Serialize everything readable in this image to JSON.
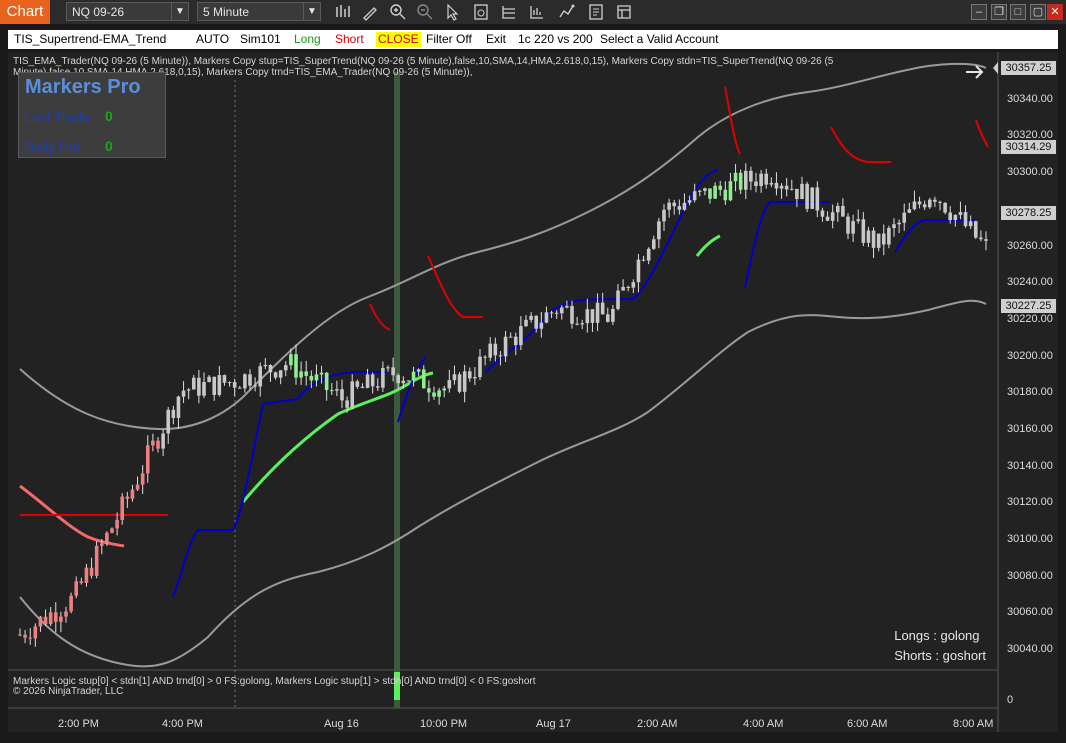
{
  "titlebar": {
    "app_tab": "Chart",
    "instrument": "NQ 09-26",
    "interval": "5 Minute",
    "window_buttons": [
      "minimize-icon",
      "restore-icon",
      "maximize-icon",
      "close-icon"
    ],
    "toolbar_icons": [
      "bar-style-icon",
      "draw-pencil-icon",
      "zoom-in-icon",
      "zoom-out-icon",
      "pointer-icon",
      "data-box-icon",
      "chart-trader-icon",
      "indicators-icon",
      "strategies-icon",
      "properties-icon",
      "templates-icon"
    ]
  },
  "strategy_bar": {
    "name": "TIS_Supertrend-EMA_Trend",
    "mode": "AUTO",
    "account": "Sim101",
    "long": "Long",
    "short": "Short",
    "close": "CLOSE",
    "filter": "Filter Off",
    "exit": "Exit",
    "ratio": "1c 220 vs 200",
    "status": "Select a Valid Account",
    "colors": {
      "long": "#1a9a1a",
      "short": "#e00000",
      "close_bg": "#ffff00",
      "close_fg": "#d40000"
    }
  },
  "chart": {
    "indicator_label": "TIS_EMA_Trader(NQ 09-26 (5 Minute)), Markers Copy stup=TIS_SuperTrend(NQ 09-26 (5 Minute),false,10,SMA,14,HMA,2.618,0,15), Markers Copy stdn=TIS_SuperTrend(NQ 09-26 (5 Minute),false,10,SMA,14,HMA,2.618,0,15), Markers Copy trnd=TIS_EMA_Trader(NQ 09-26 (5 Minute)),",
    "markers_pro": {
      "title": "Markers Pro",
      "last_trade_label": "Last Trade",
      "last_trade_value": "0",
      "daily_pnl_label": "Daily PnL",
      "daily_pnl_value": "0"
    },
    "logic_line": "Markers Logic stup[0] < stdn[1] AND trnd[0] > 0  FS:golong, Markers Logic stup[1] > stdn[0] AND trnd[0] < 0  FS:goshort",
    "copyright": "© 2026 NinjaTrader, LLC",
    "signals": {
      "longs": "Longs : golong",
      "shorts": "Shorts : goshort"
    },
    "x_axis_labels": [
      "2:00 PM",
      "4:00 PM",
      "Aug 16",
      "10:00 PM",
      "Aug 17",
      "2:00 AM",
      "4:00 AM",
      "6:00 AM",
      "8:00 AM"
    ],
    "y_axis_labels": [
      "30340.00",
      "30320.00",
      "30300.00",
      "30260.00",
      "30240.00",
      "30220.00",
      "30200.00",
      "30180.00",
      "30160.00",
      "30140.00",
      "30120.00",
      "30100.00",
      "30080.00",
      "30060.00",
      "30040.00"
    ],
    "y_axis_zero": "0",
    "price_tags": [
      {
        "value": "30357.25",
        "kind": "upper-band"
      },
      {
        "value": "30314.29",
        "kind": "supertrend"
      },
      {
        "value": "30278.25",
        "kind": "last-price"
      },
      {
        "value": "30227.25",
        "kind": "lower-band"
      }
    ],
    "colors": {
      "background": "#222222",
      "bull_candle": "#90ee90",
      "bear_candle": "#f08080",
      "neutral_candle": "#c8c8c8",
      "supertrend_up": "#0000cd",
      "supertrend_down": "#e00000",
      "ema_up": "#5cf05c",
      "ema_down": "#f06a6a",
      "band": "#9a9a9a",
      "signal_bar": "#3c5a3c"
    },
    "chart_data": {
      "type": "candlestick",
      "instrument": "NQ 09-26",
      "interval": "5 Minute",
      "ylim": [
        30030,
        30360
      ],
      "close_series": [
        [
          "2:00 PM",
          30065
        ],
        [
          "3:00 PM",
          30085
        ],
        [
          "4:00 PM",
          30140
        ],
        [
          "5:00 PM",
          30200
        ],
        [
          "6:00 PM",
          30205
        ],
        [
          "Aug 16",
          30215
        ],
        [
          "8:00 PM",
          30195
        ],
        [
          "9:00 PM",
          30210
        ],
        [
          "10:00 PM",
          30200
        ],
        [
          "11:00 PM",
          30225
        ],
        [
          "Aug 17",
          30245
        ],
        [
          "1:00 AM",
          30240
        ],
        [
          "2:00 AM",
          30300
        ],
        [
          "3:00 AM",
          30310
        ],
        [
          "4:00 AM",
          30320
        ],
        [
          "5:00 AM",
          30300
        ],
        [
          "6:00 AM",
          30280
        ],
        [
          "7:00 AM",
          30310
        ],
        [
          "8:00 AM",
          30278.25
        ]
      ]
    }
  }
}
